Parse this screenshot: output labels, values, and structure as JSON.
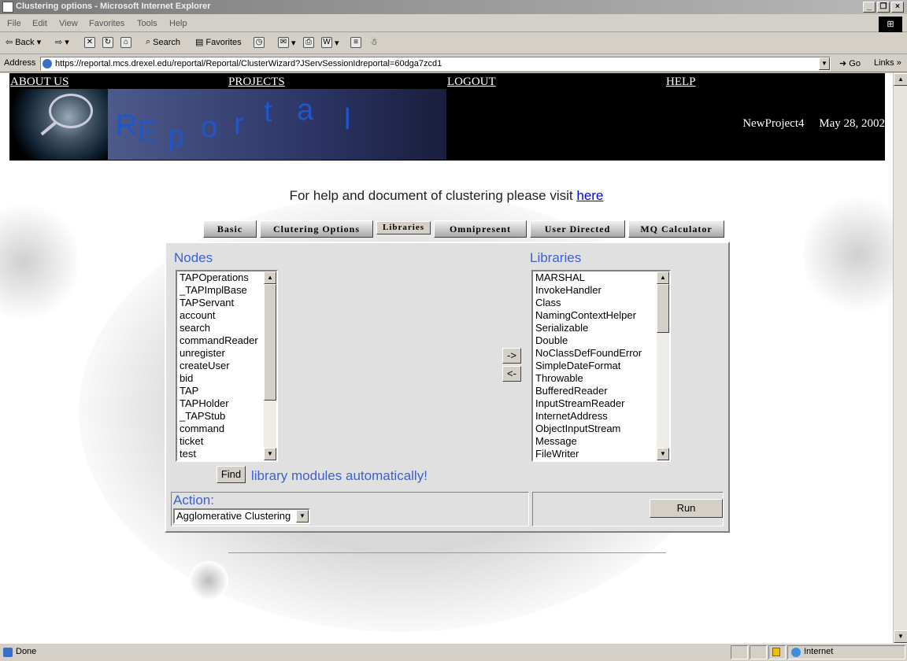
{
  "window": {
    "title": "Clustering options - Microsoft Internet Explorer",
    "minimize": "_",
    "restore": "❐",
    "close": "×"
  },
  "menu": [
    "File",
    "Edit",
    "View",
    "Favorites",
    "Tools",
    "Help"
  ],
  "toolbar": {
    "back": "Back",
    "search": "Search",
    "favorites": "Favorites"
  },
  "address": {
    "label": "Address",
    "url": "https://reportal.mcs.drexel.edu/reportal/Reportal/ClusterWizard?JServSessionIdreportal=60dga7zcd1",
    "go": "Go",
    "links": "Links"
  },
  "nav": {
    "about": "ABOUT US",
    "projects": "PROJECTS",
    "logout": "LOGOUT",
    "help": "HELP"
  },
  "banner": {
    "logo_letters": [
      "R",
      "E",
      "p",
      "o",
      "r",
      "t",
      "a",
      "l"
    ],
    "project": "NewProject4",
    "date": "May 28, 2002"
  },
  "help": {
    "text": "For help and document of clustering please visit ",
    "link": "here"
  },
  "tabs": [
    "Basic",
    "Clutering Options",
    "Libraries",
    "Omnipresent",
    "User Directed",
    "MQ Calculator"
  ],
  "nodes": {
    "title": "Nodes",
    "items": [
      "TAPOperations",
      "_TAPImplBase",
      "TAPServant",
      "account",
      "search",
      "commandReader",
      "unregister",
      "createUser",
      "bid",
      "TAP",
      "TAPHolder",
      "_TAPStub",
      "command",
      "ticket",
      "test"
    ]
  },
  "libraries": {
    "title": "Libraries",
    "items": [
      "MARSHAL",
      "InvokeHandler",
      "Class",
      "NamingContextHelper",
      "Serializable",
      "Double",
      "NoClassDefFoundError",
      "SimpleDateFormat",
      "Throwable",
      "BufferedReader",
      "InputStreamReader",
      "InternetAddress",
      "ObjectInputStream",
      "Message",
      "FileWriter"
    ]
  },
  "move": {
    "right": "->",
    "left": "<-"
  },
  "find": {
    "button": "Find",
    "message": "library modules automatically!"
  },
  "action": {
    "label": "Action:",
    "selected": "Agglomerative Clustering",
    "run": "Run"
  },
  "status": {
    "text": "Done",
    "zone": "Internet"
  }
}
